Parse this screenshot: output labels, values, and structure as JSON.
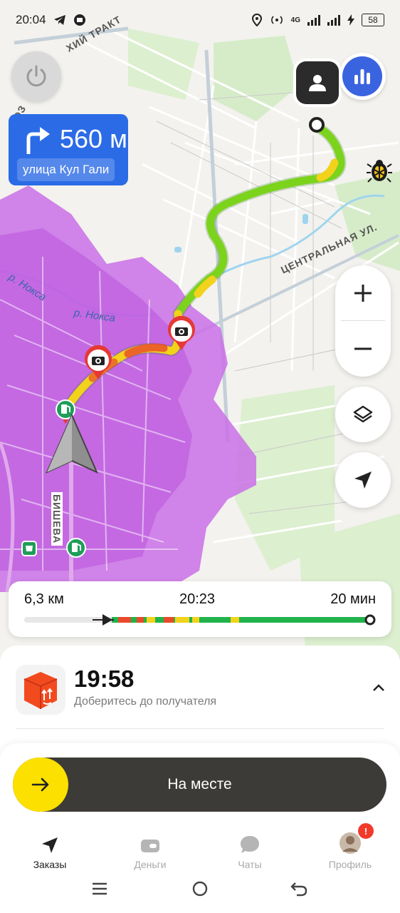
{
  "status_bar": {
    "time": "20:04",
    "network": "4G",
    "battery": "58"
  },
  "map": {
    "streets": [
      "ЦЕНТРАЛЬНАЯ УЛ.",
      "БИШЕВА",
      "ХИЙ ТРАКТ",
      "РОЗ"
    ],
    "rivers": [
      "р. Нокса",
      "р. Нокса"
    ]
  },
  "maneuver": {
    "distance": "560 м",
    "street": "улица Кул Гали",
    "direction": "turn-right"
  },
  "route": {
    "distance": "6,3 км",
    "arrival": "20:23",
    "duration": "20 мин",
    "progress_fraction": 0.25
  },
  "order": {
    "time": "19:58",
    "hint": "Доберитесь до получателя"
  },
  "action": {
    "label": "На месте"
  },
  "tabs": [
    {
      "label": "Заказы",
      "icon": "navigation-arrow-icon",
      "active": true
    },
    {
      "label": "Деньги",
      "icon": "wallet-icon",
      "active": false
    },
    {
      "label": "Чаты",
      "icon": "chat-bubble-icon",
      "active": false
    },
    {
      "label": "Профиль",
      "icon": "avatar-icon",
      "active": false,
      "badge": "!"
    }
  ],
  "colors": {
    "accent_blue": "#2b6be6",
    "route_green": "#7bd31c",
    "traffic_yellow": "#f2d21b",
    "traffic_red": "#e84a2b",
    "zone_purple": "#c970e6",
    "slider_knob": "#fce000",
    "slider_bg": "#3c3b37"
  }
}
